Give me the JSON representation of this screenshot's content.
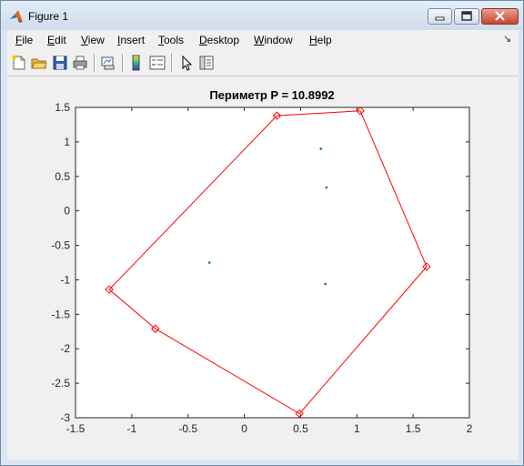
{
  "window": {
    "title": "Figure 1",
    "minimize_icon": "minimize-icon",
    "maximize_icon": "maximize-icon",
    "close_icon": "close-icon"
  },
  "menubar": {
    "items": [
      {
        "label": "File",
        "u": "F",
        "rest": "ile"
      },
      {
        "label": "Edit",
        "u": "E",
        "rest": "dit"
      },
      {
        "label": "View",
        "u": "V",
        "rest": "iew"
      },
      {
        "label": "Insert",
        "u": "I",
        "rest": "nsert"
      },
      {
        "label": "Tools",
        "u": "T",
        "rest": "ools"
      },
      {
        "label": "Desktop",
        "u": "D",
        "rest": "esktop"
      },
      {
        "label": "Window",
        "u": "W",
        "rest": "indow"
      },
      {
        "label": "Help",
        "u": "H",
        "rest": "elp"
      }
    ]
  },
  "toolbar": {
    "icons": [
      "new-figure-icon",
      "open-file-icon",
      "save-icon",
      "print-icon",
      "link-plot-icon",
      "colorbar-icon",
      "legend-icon",
      "edit-plot-arrow-icon",
      "property-inspector-icon"
    ]
  },
  "colors": {
    "polygon": "#ff0000",
    "points": "#0072bd"
  },
  "chart_data": {
    "type": "scatter",
    "title": "Периметр P = 10.8992",
    "xlim": [
      -1.5,
      2
    ],
    "ylim": [
      -3,
      1.5
    ],
    "xticks": [
      -1.5,
      -1,
      -0.5,
      0,
      0.5,
      1,
      1.5,
      2
    ],
    "xtick_labels": [
      "-1.5",
      "-1",
      "-0.5",
      "0",
      "0.5",
      "1",
      "1.5",
      "2"
    ],
    "yticks": [
      1.5,
      1,
      0.5,
      0,
      -0.5,
      -1,
      -1.5,
      -2,
      -2.5,
      -3
    ],
    "ytick_labels": [
      "1.5",
      "1",
      "0.5",
      "0",
      "-0.5",
      "-1",
      "-1.5",
      "-2",
      "-2.5",
      "-3"
    ],
    "grid": false,
    "series": [
      {
        "kind": "polygon",
        "marker": "diamond",
        "x": [
          1.03,
          1.62,
          0.49,
          -0.79,
          -1.2,
          0.29,
          1.03
        ],
        "y": [
          1.45,
          -0.81,
          -2.94,
          -1.71,
          -1.14,
          1.38,
          1.45
        ]
      },
      {
        "kind": "points",
        "marker": "dot",
        "x": [
          0.68,
          0.73,
          -0.31,
          0.72
        ],
        "y": [
          0.9,
          0.34,
          -0.75,
          -1.06
        ]
      }
    ]
  }
}
